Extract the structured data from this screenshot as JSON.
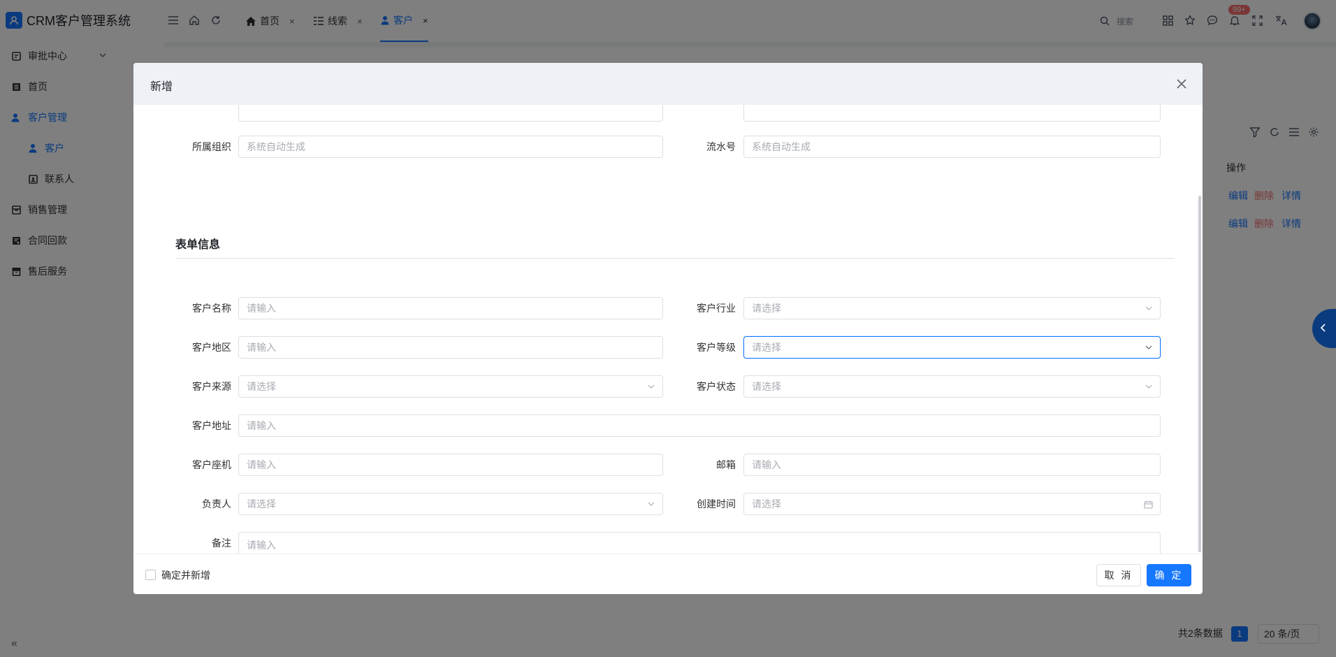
{
  "app": {
    "title": "CRM客户管理系统"
  },
  "sidebar": {
    "items": [
      {
        "label": "审批中心"
      },
      {
        "label": "首页"
      },
      {
        "label": "客户管理"
      },
      {
        "label": "客户"
      },
      {
        "label": "联系人"
      },
      {
        "label": "销售管理"
      },
      {
        "label": "合同回款"
      },
      {
        "label": "售后服务"
      }
    ]
  },
  "topbar": {
    "tabs": [
      {
        "label": "首页",
        "close": "×"
      },
      {
        "label": "线索",
        "close": "×"
      },
      {
        "label": "客户",
        "close": "×"
      }
    ],
    "search_placeholder": "搜索",
    "notification_count": "99+"
  },
  "table": {
    "op_header": "操作",
    "rows": [
      {
        "edit": "编辑",
        "delete": "删除",
        "detail": "详情"
      },
      {
        "edit": "编辑",
        "delete": "删除",
        "detail": "详情"
      }
    ],
    "total_text": "共2条数据",
    "current_page": "1",
    "page_size": "20 条/页"
  },
  "colors": {
    "primary": "#1677ff",
    "danger": "#f56c6c",
    "mask": "rgba(0,0,0,0.5)"
  },
  "dialog": {
    "title": "新增",
    "fields": {
      "org": {
        "label": "所属组织",
        "placeholder": "系统自动生成"
      },
      "serial": {
        "label": "流水号",
        "placeholder": "系统自动生成"
      },
      "name": {
        "label": "客户名称",
        "placeholder": "请输入"
      },
      "industry": {
        "label": "客户行业",
        "placeholder": "请选择"
      },
      "region": {
        "label": "客户地区",
        "placeholder": "请输入"
      },
      "level": {
        "label": "客户等级",
        "placeholder": "请选择"
      },
      "source": {
        "label": "客户来源",
        "placeholder": "请选择"
      },
      "status": {
        "label": "客户状态",
        "placeholder": "请选择"
      },
      "address": {
        "label": "客户地址",
        "placeholder": "请输入"
      },
      "phone": {
        "label": "客户座机",
        "placeholder": "请输入"
      },
      "email": {
        "label": "邮箱",
        "placeholder": "请输入"
      },
      "owner": {
        "label": "负责人",
        "placeholder": "请选择"
      },
      "created": {
        "label": "创建时间",
        "placeholder": "请选择"
      },
      "remark": {
        "label": "备注",
        "placeholder": "请输入"
      }
    },
    "section_title": "表单信息",
    "footer": {
      "continue_label": "确定并新增",
      "cancel": "取 消",
      "ok": "确 定"
    }
  }
}
